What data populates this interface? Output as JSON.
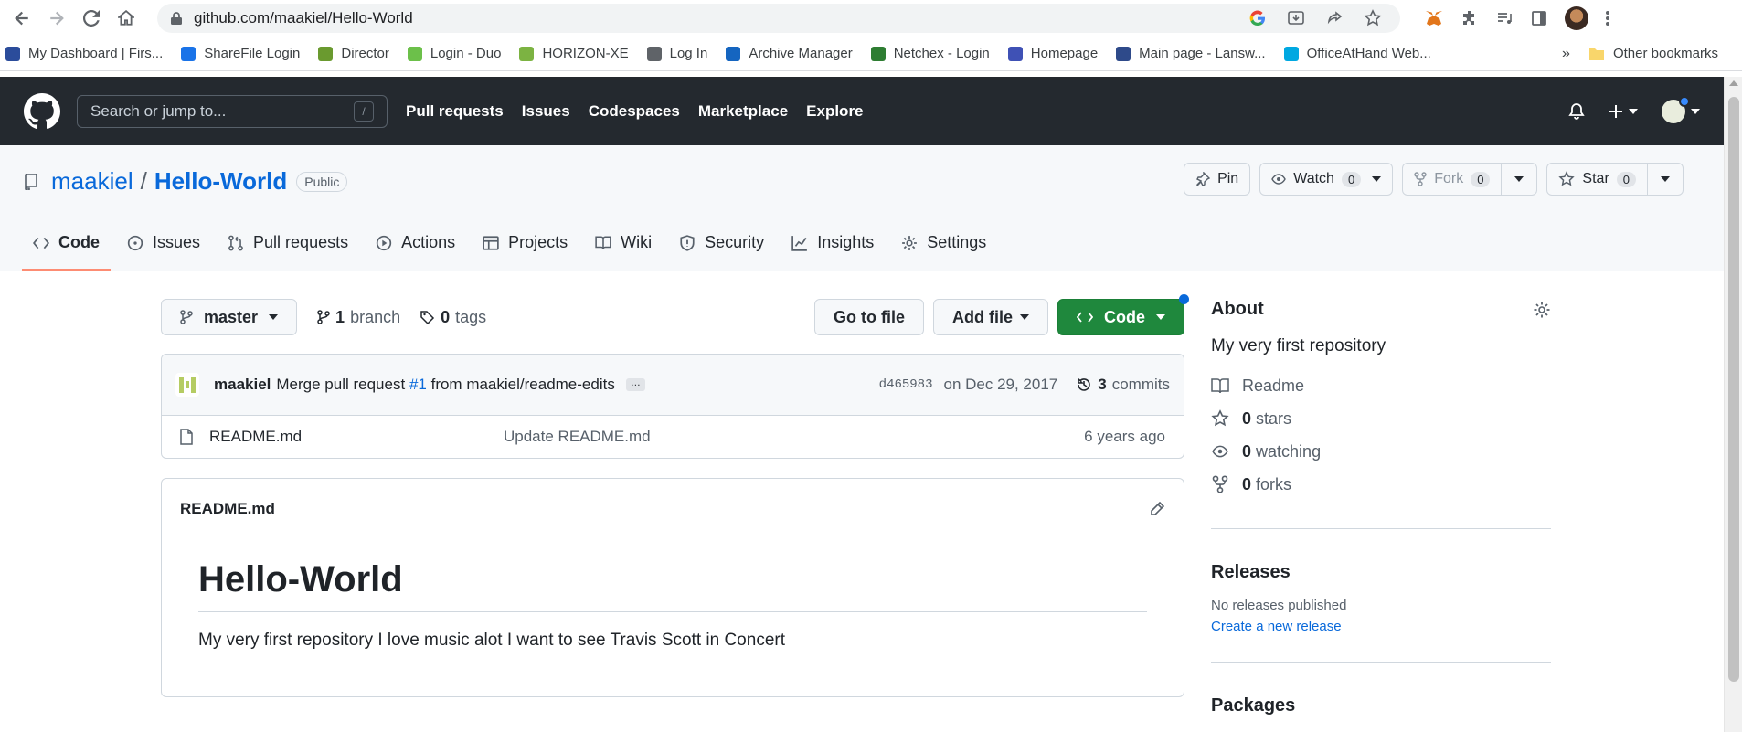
{
  "browser": {
    "url": "github.com/maakiel/Hello-World",
    "bookmarks": [
      {
        "label": "My Dashboard | Firs...",
        "color": "#2b4c9b"
      },
      {
        "label": "ShareFile Login",
        "color": "#1a73e8"
      },
      {
        "label": "Director",
        "color": "#6a9a2f"
      },
      {
        "label": "Login - Duo",
        "color": "#6cc04a"
      },
      {
        "label": "HORIZON-XE",
        "color": "#7cb342"
      },
      {
        "label": "Log In",
        "color": "#5f6368"
      },
      {
        "label": "Archive Manager",
        "color": "#1565c0"
      },
      {
        "label": "Netchex - Login",
        "color": "#2e7d32"
      },
      {
        "label": "Homepage",
        "color": "#3f51b5"
      },
      {
        "label": "Main page - Lansw...",
        "color": "#2e4a8a"
      },
      {
        "label": "OfficeAtHand Web...",
        "color": "#00a8e1"
      }
    ],
    "bookmarks_more": "»",
    "other_bookmarks": "Other bookmarks"
  },
  "github": {
    "search_placeholder": "Search or jump to...",
    "search_shortcut": "/",
    "nav": [
      "Pull requests",
      "Issues",
      "Codespaces",
      "Marketplace",
      "Explore"
    ]
  },
  "repo": {
    "owner": "maakiel",
    "separator": "/",
    "name": "Hello-World",
    "visibility": "Public",
    "pin_label": "Pin",
    "watch_label": "Watch",
    "watch_count": "0",
    "fork_label": "Fork",
    "fork_count": "0",
    "star_label": "Star",
    "star_count": "0",
    "tabs": [
      {
        "label": "Code",
        "icon": "code-icon"
      },
      {
        "label": "Issues",
        "icon": "issue-icon"
      },
      {
        "label": "Pull requests",
        "icon": "pull-request-icon"
      },
      {
        "label": "Actions",
        "icon": "play-icon"
      },
      {
        "label": "Projects",
        "icon": "table-icon"
      },
      {
        "label": "Wiki",
        "icon": "book-icon"
      },
      {
        "label": "Security",
        "icon": "shield-icon"
      },
      {
        "label": "Insights",
        "icon": "graph-icon"
      },
      {
        "label": "Settings",
        "icon": "gear-icon"
      }
    ]
  },
  "toolbar": {
    "branch": "master",
    "branch_count": "1",
    "branch_word": "branch",
    "tag_count": "0",
    "tag_word": "tags",
    "go_to_file": "Go to file",
    "add_file": "Add file",
    "code": "Code"
  },
  "commit": {
    "author": "maakiel",
    "message_prefix": "Merge pull request",
    "pr_link": "#1",
    "message_suffix": "from maakiel/readme-edits",
    "ellipsis": "…",
    "sha": "d465983",
    "date": "on Dec 29, 2017",
    "commit_count": "3",
    "commit_word": "commits"
  },
  "files": [
    {
      "name": "README.md",
      "commit": "Update README.md",
      "age": "6 years ago"
    }
  ],
  "readme": {
    "filename": "README.md",
    "heading": "Hello-World",
    "body": "My very first repository I love music alot I want to see Travis Scott in Concert"
  },
  "about": {
    "heading": "About",
    "description": "My very first repository",
    "readme_label": "Readme",
    "stars_count": "0",
    "stars_word": "stars",
    "watching_count": "0",
    "watching_word": "watching",
    "forks_count": "0",
    "forks_word": "forks"
  },
  "releases": {
    "heading": "Releases",
    "none_text": "No releases published",
    "create_link": "Create a new release"
  },
  "packages": {
    "heading": "Packages"
  }
}
